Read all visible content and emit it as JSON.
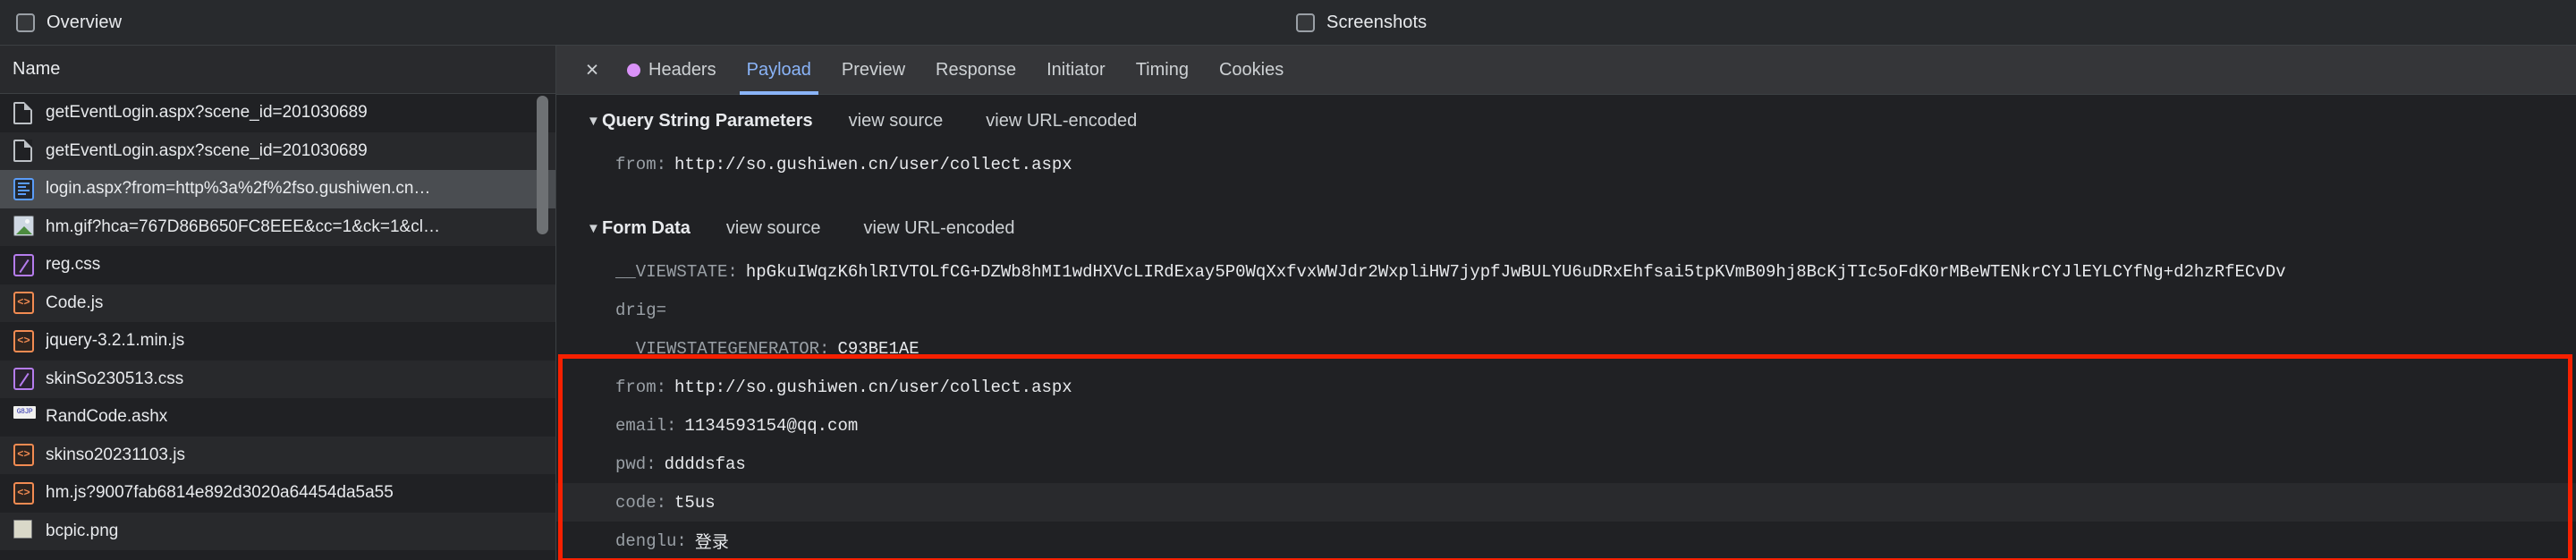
{
  "toolbar": {
    "overview_label": "Overview",
    "screenshots_label": "Screenshots"
  },
  "request_list": {
    "column_header": "Name",
    "items": [
      {
        "label": "getEventLogin.aspx?scene_id=201030689",
        "icon": "document-icon"
      },
      {
        "label": "getEventLogin.aspx?scene_id=201030689",
        "icon": "document-icon"
      },
      {
        "label": "login.aspx?from=http%3a%2f%2fso.gushiwen.cn…",
        "icon": "html-document-icon"
      },
      {
        "label": "hm.gif?hca=767D86B650FC8EEE&cc=1&ck=1&cl…",
        "icon": "image-icon"
      },
      {
        "label": "reg.css",
        "icon": "stylesheet-icon"
      },
      {
        "label": "Code.js",
        "icon": "script-icon"
      },
      {
        "label": "jquery-3.2.1.min.js",
        "icon": "script-icon"
      },
      {
        "label": "skinSo230513.css",
        "icon": "stylesheet-icon"
      },
      {
        "label": "RandCode.ashx",
        "icon": "captcha-image-icon"
      },
      {
        "label": "skinso20231103.js",
        "icon": "script-icon"
      },
      {
        "label": "hm.js?9007fab6814e892d3020a64454da5a55",
        "icon": "script-icon"
      },
      {
        "label": "bcpic.png",
        "icon": "png-image-icon"
      }
    ],
    "selected_index": 2
  },
  "detail": {
    "close_label": "×",
    "tabs": [
      {
        "label": "Headers",
        "has_dot": true,
        "active": false
      },
      {
        "label": "Payload",
        "has_dot": false,
        "active": true
      },
      {
        "label": "Preview",
        "has_dot": false,
        "active": false
      },
      {
        "label": "Response",
        "has_dot": false,
        "active": false
      },
      {
        "label": "Initiator",
        "has_dot": false,
        "active": false
      },
      {
        "label": "Timing",
        "has_dot": false,
        "active": false
      },
      {
        "label": "Cookies",
        "has_dot": false,
        "active": false
      }
    ],
    "query_string": {
      "twisty": "▼",
      "title": "Query String Parameters",
      "view_source_label": "view source",
      "view_url_encoded_label": "view URL-encoded",
      "params": [
        {
          "key": "from:",
          "value": "http://so.gushiwen.cn/user/collect.aspx"
        }
      ]
    },
    "form_data": {
      "twisty": "▼",
      "title": "Form Data",
      "view_source_label": "view source",
      "view_url_encoded_label": "view URL-encoded",
      "params": [
        {
          "key": "__VIEWSTATE:",
          "value": "hpGkuIWqzK6hlRIVTOLfCG+DZWb8hMI1wdHXVcLIRdExay5P0WqXxfvxWWJdr2WxpliHW7jypfJwBULYU6uDRxEhfsai5tpKVmB09hj8BcKjTIc5oFdK0rMBeWTENkrCYJlEYLCYfNg+d2hzRfECvDv"
        },
        {
          "key": "drig=",
          "value": ""
        },
        {
          "key": "__VIEWSTATEGENERATOR:",
          "value": "C93BE1AE"
        },
        {
          "key": "from:",
          "value": "http://so.gushiwen.cn/user/collect.aspx"
        },
        {
          "key": "email:",
          "value": "1134593154@qq.com"
        },
        {
          "key": "pwd:",
          "value": "ddddsfas"
        },
        {
          "key": "code:",
          "value": "t5us"
        },
        {
          "key": "denglu:",
          "value": "登录"
        }
      ]
    },
    "highlight_color": "#f62000"
  }
}
